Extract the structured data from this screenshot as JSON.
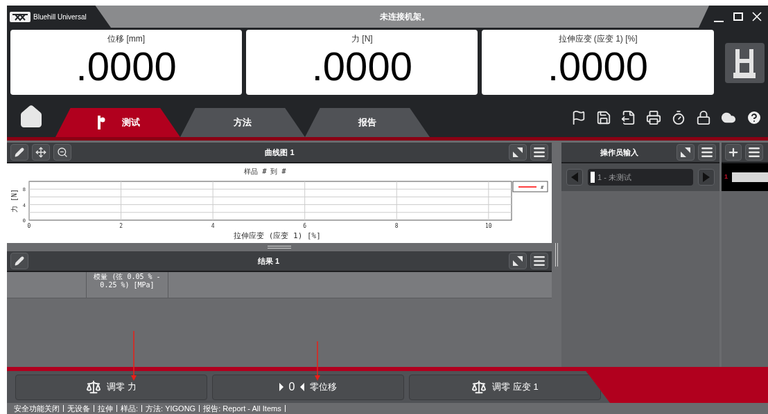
{
  "title_bar": {
    "app_name": "Bluehill Universal",
    "status": "未连接机架。"
  },
  "readouts": [
    {
      "label": "位移 [mm]",
      "value": ".0000"
    },
    {
      "label": "力 [N]",
      "value": ".0000"
    },
    {
      "label": "拉伸应变 (应变 1) [%]",
      "value": ".0000"
    }
  ],
  "tabs": [
    {
      "label": "测试",
      "selected": true
    },
    {
      "label": "方法",
      "selected": false
    },
    {
      "label": "报告",
      "selected": false
    }
  ],
  "graph_panel": {
    "title": "曲线图 1",
    "chart_data": {
      "type": "line",
      "title": "样品 # 到 #",
      "xlabel": "拉伸应变 (应变 1) [%]",
      "ylabel": "力 [N]",
      "grid": true,
      "categories": [
        "0",
        "2",
        "4",
        "6",
        "8",
        "10"
      ],
      "ylim": [
        0,
        10
      ],
      "yticks": [
        0,
        4,
        8
      ],
      "series": [
        {
          "name": "#",
          "color": "#ff0000",
          "values": [
            null,
            null,
            null,
            null,
            null,
            null
          ]
        }
      ]
    }
  },
  "results_panel": {
    "title": "结果 1",
    "columns": [
      "模量 (弦 0.05 % - 0.25 %) [MPa]"
    ]
  },
  "operator_panel": {
    "title": "操作员输入",
    "specimen": "1 - 未测试"
  },
  "specimen_strip": {
    "row_number": "1"
  },
  "bottom_buttons": [
    {
      "kind": "balance",
      "label": "调零 力"
    },
    {
      "kind": "zero",
      "prefix": "0",
      "label": "零位移"
    },
    {
      "kind": "balance",
      "label": "调零 应变 1"
    }
  ],
  "status_bar": [
    "安全功能关闭",
    "无设备",
    "拉伸",
    "样品:",
    "方法: YIGONG",
    "报告: Report - All Items"
  ]
}
